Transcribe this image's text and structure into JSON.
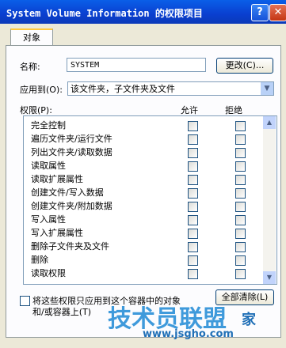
{
  "window": {
    "title": "System Volume Information 的权限项目",
    "help_label": "?",
    "close_label": "✕"
  },
  "tabs": [
    {
      "label": "对象"
    }
  ],
  "name": {
    "label": "名称:",
    "value": "SYSTEM",
    "change_button": "更改(C)..."
  },
  "apply_to": {
    "label": "应用到(O):",
    "value": "该文件夹，子文件夹及文件"
  },
  "permissions": {
    "label": "权限(P):",
    "allow_header": "允许",
    "deny_header": "拒绝",
    "rows": [
      {
        "label": "完全控制",
        "allow": false,
        "deny": false
      },
      {
        "label": "遍历文件夹/运行文件",
        "allow": false,
        "deny": false
      },
      {
        "label": "列出文件夹/读取数据",
        "allow": false,
        "deny": false
      },
      {
        "label": "读取属性",
        "allow": false,
        "deny": false
      },
      {
        "label": "读取扩展属性",
        "allow": false,
        "deny": false
      },
      {
        "label": "创建文件/写入数据",
        "allow": false,
        "deny": false
      },
      {
        "label": "创建文件夹/附加数据",
        "allow": false,
        "deny": false
      },
      {
        "label": "写入属性",
        "allow": false,
        "deny": false
      },
      {
        "label": "写入扩展属性",
        "allow": false,
        "deny": false
      },
      {
        "label": "删除子文件夹及文件",
        "allow": false,
        "deny": false
      },
      {
        "label": "删除",
        "allow": false,
        "deny": false
      },
      {
        "label": "读取权限",
        "allow": false,
        "deny": false
      }
    ]
  },
  "footer": {
    "apply_checkbox_line1": "将这些权限只应用到这个容器中的对象",
    "apply_checkbox_line2": "和/或容器上(T)",
    "clear_all_button": "全部清除(L)"
  },
  "watermark": {
    "brand": "技术员联盟",
    "url": "www.jsgho.com",
    "tail": "家"
  },
  "icons": {
    "help": "help-icon",
    "close": "close-icon",
    "dropdown": "chevron-down-icon",
    "scroll_up": "scroll-up-icon",
    "scroll_down": "scroll-down-icon"
  },
  "colors": {
    "titlebar": "#0a4fd8",
    "checkbox_border": "#1c5180",
    "face": "#ece9d8"
  }
}
